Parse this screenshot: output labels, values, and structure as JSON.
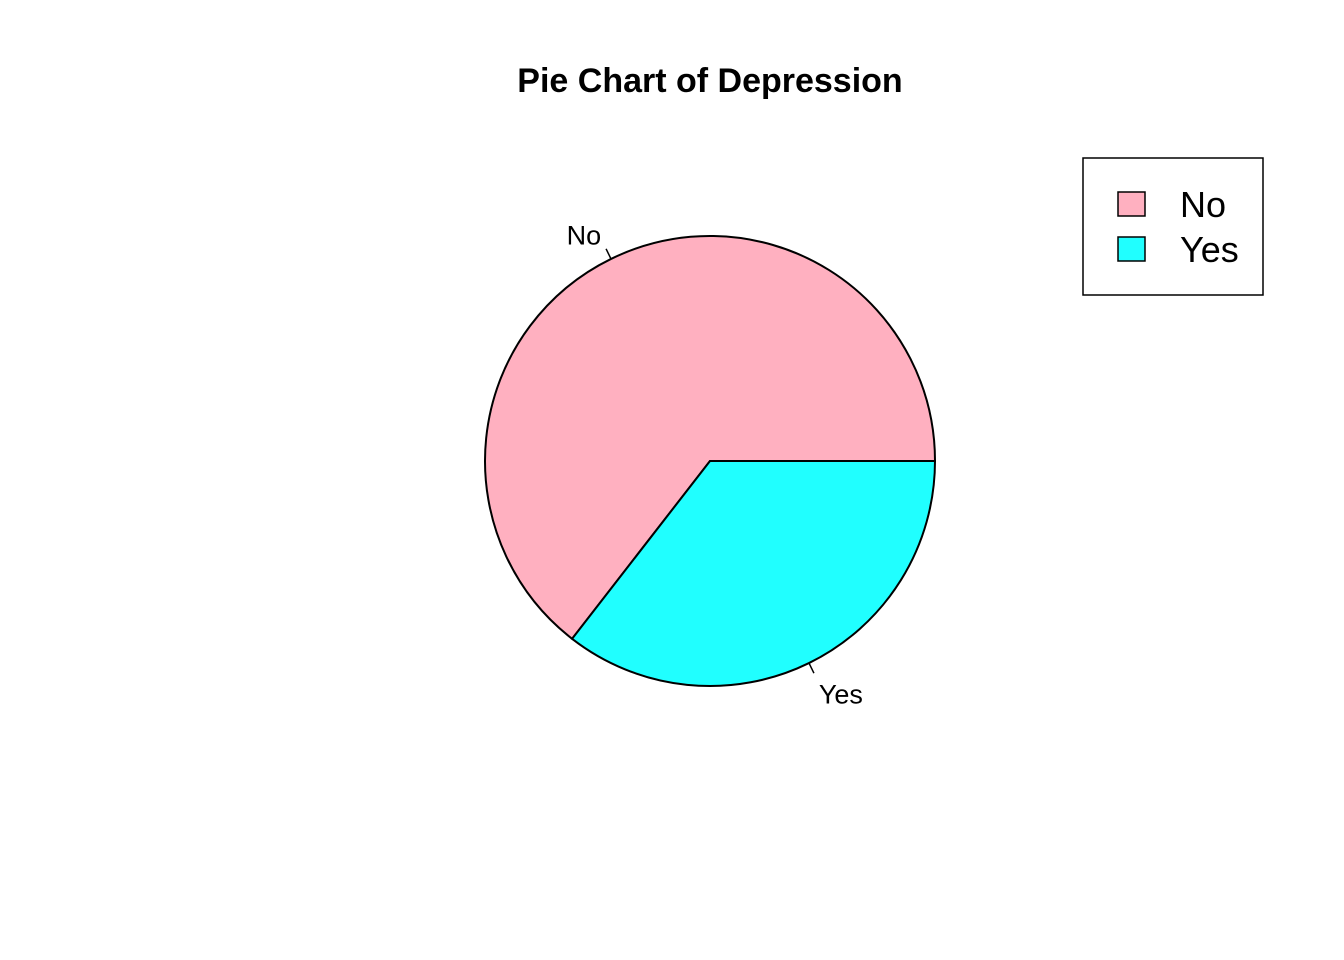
{
  "chart_data": {
    "type": "pie",
    "title": "Pie Chart of Depression",
    "categories": [
      "No",
      "Yes"
    ],
    "values": [
      64.5,
      35.5
    ],
    "colors": [
      "#FFB0C0",
      "#20FFFF"
    ],
    "legend": {
      "position": "top-right",
      "entries": [
        "No",
        "Yes"
      ]
    }
  }
}
